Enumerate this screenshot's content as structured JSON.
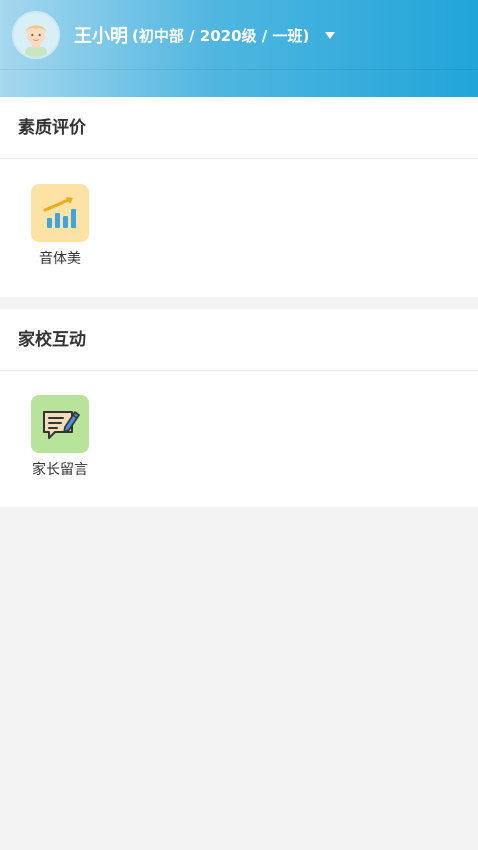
{
  "header": {
    "user_name": "王小明",
    "user_detail": "(初中部 / 2020级 / 一班)",
    "avatar": "child-avatar-icon",
    "dropdown": "caret-down-icon"
  },
  "sections": [
    {
      "title": "素质评价",
      "apps": [
        {
          "label": "音体美",
          "icon": "bar-chart-trend-icon",
          "color": "#fbe3a5"
        }
      ]
    },
    {
      "title": "家校互动",
      "apps": [
        {
          "label": "家长留言",
          "icon": "message-edit-icon",
          "color": "#b8e39b"
        }
      ]
    }
  ],
  "colors": {
    "header_start": "#a6d8ee",
    "header_end": "#21a5d9",
    "background": "#f3f3f3"
  }
}
